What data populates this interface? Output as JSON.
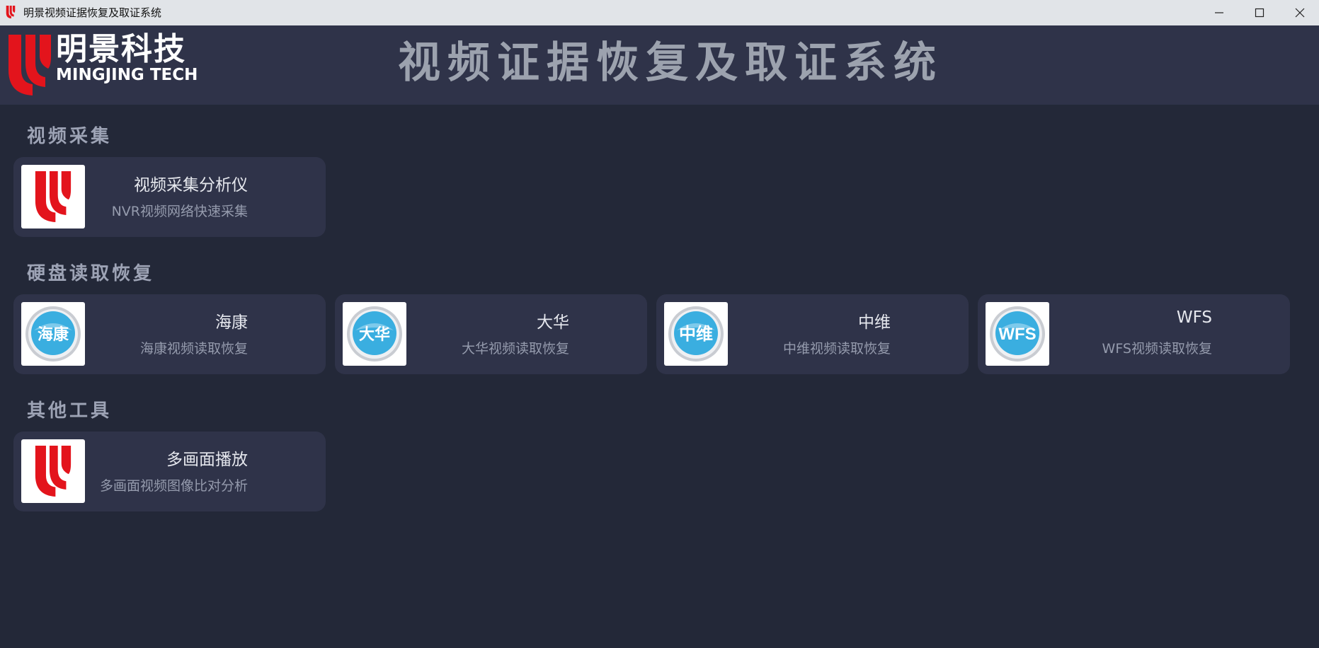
{
  "window": {
    "title": "明景视频证据恢复及取证系统",
    "controls": {
      "minimize": "minimize-icon",
      "maximize": "maximize-icon",
      "close": "close-icon"
    }
  },
  "header": {
    "brand_cn": "明景科技",
    "brand_en": "MINGJING TECH",
    "app_title": "视频证据恢复及取证系统"
  },
  "colors": {
    "background": "#232838",
    "card": "#2f3349",
    "brand_red": "#e3141c",
    "badge_blue": "#3aaee0"
  },
  "sections": [
    {
      "title": "视频采集",
      "cards": [
        {
          "icon": "mingjing-logo-icon",
          "title": "视频采集分析仪",
          "desc": "NVR视频网络快速采集"
        }
      ]
    },
    {
      "title": "硬盘读取恢复",
      "cards": [
        {
          "icon": "hikvision-badge-icon",
          "badge": "海康",
          "title": "海康",
          "desc": "海康视频读取恢复"
        },
        {
          "icon": "dahua-badge-icon",
          "badge": "大华",
          "title": "大华",
          "desc": "大华视频读取恢复"
        },
        {
          "icon": "zhongwei-badge-icon",
          "badge": "中维",
          "title": "中维",
          "desc": "中维视频读取恢复"
        },
        {
          "icon": "wfs-badge-icon",
          "badge": "WFS",
          "title": "WFS",
          "desc": "WFS视频读取恢复"
        }
      ]
    },
    {
      "title": "其他工具",
      "cards": [
        {
          "icon": "mingjing-logo-icon",
          "title": "多画面播放",
          "desc": "多画面视频图像比对分析"
        }
      ]
    }
  ]
}
